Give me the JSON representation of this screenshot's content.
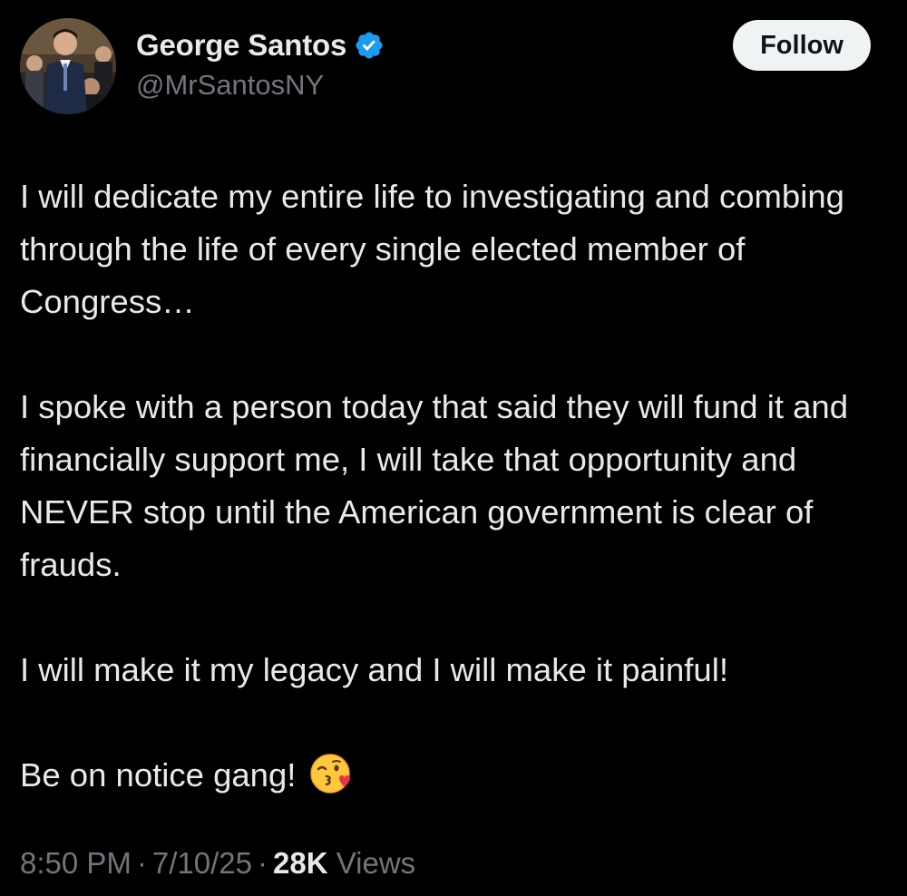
{
  "author": {
    "display_name": "George Santos",
    "handle": "@MrSantosNY",
    "verified_icon": "verified-badge-icon",
    "avatar_icon": "profile-avatar"
  },
  "actions": {
    "follow_label": "Follow"
  },
  "tweet": {
    "paragraphs": [
      "I will dedicate my entire life to investigating and combing through the life of every single elected member of Congress…",
      "I spoke with a person today that said they will fund it and financially support me, I will take that opportunity and NEVER stop until the American government is clear of frauds.",
      "I will make it my legacy and I will make it painful!",
      "Be on notice gang!"
    ],
    "emoji": "face-blowing-a-kiss-icon"
  },
  "meta": {
    "time": "8:50 PM",
    "separator": "·",
    "date": "7/10/25",
    "views_count": "28K",
    "views_label": "Views"
  },
  "colors": {
    "background": "#000000",
    "primary_text": "#e7e9ea",
    "secondary_text": "#71767b",
    "verified_blue": "#1d9bf0",
    "follow_bg": "#eff3f4",
    "follow_text": "#0f1419"
  }
}
